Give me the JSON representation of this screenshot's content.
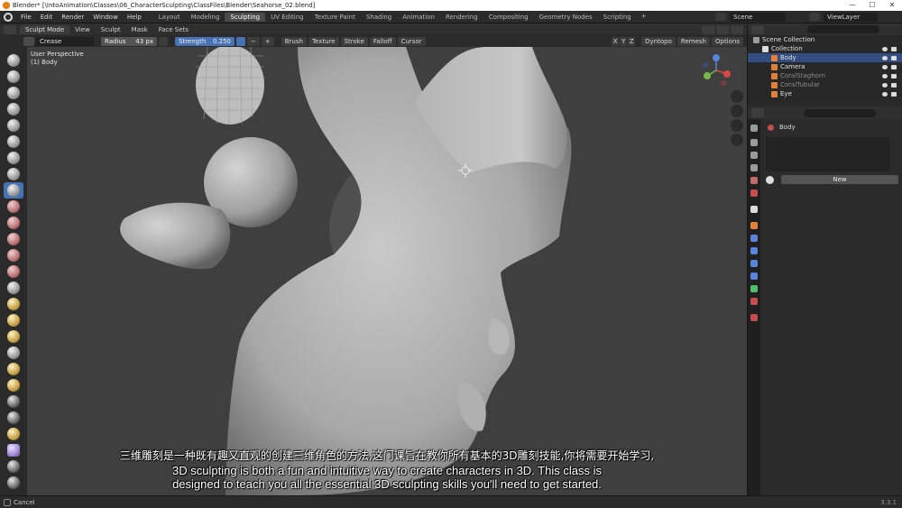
{
  "window": {
    "title": "Blender* [\\IntoAnimation\\Classes\\06_CharacterSculpting\\ClassFiles\\Blender\\Seahorse_02.blend]",
    "controls": [
      "—",
      "☐",
      "✕"
    ]
  },
  "menu": [
    "File",
    "Edit",
    "Render",
    "Window",
    "Help"
  ],
  "workspaces": [
    {
      "label": "Layout",
      "active": false
    },
    {
      "label": "Modeling",
      "active": false
    },
    {
      "label": "Sculpting",
      "active": true
    },
    {
      "label": "UV Editing",
      "active": false
    },
    {
      "label": "Texture Paint",
      "active": false
    },
    {
      "label": "Shading",
      "active": false
    },
    {
      "label": "Animation",
      "active": false
    },
    {
      "label": "Rendering",
      "active": false
    },
    {
      "label": "Compositing",
      "active": false
    },
    {
      "label": "Geometry Nodes",
      "active": false
    },
    {
      "label": "Scripting",
      "active": false
    }
  ],
  "workspace_add": "+",
  "scene": {
    "label": "Scene"
  },
  "view_layer": {
    "label": "ViewLayer"
  },
  "viewport_header": {
    "mode": "Sculpt Mode",
    "menus": [
      "View",
      "Sculpt",
      "Mask",
      "Face Sets"
    ],
    "axes": [
      "X",
      "Y",
      "Z"
    ],
    "dyntopo": "Dyntopo",
    "remesh": "Remesh",
    "options": "Options"
  },
  "tool_settings": {
    "brush_name": "Crease",
    "radius_label": "Radius",
    "radius_value": "43 px",
    "strength_label": "Strength",
    "strength_value": "0.250",
    "minus": "−",
    "plus": "+",
    "dropdowns": [
      "Brush",
      "Texture",
      "Stroke",
      "Falloff",
      "Cursor"
    ]
  },
  "viewport": {
    "perspective": "User Perspective",
    "object": "(1) Body"
  },
  "subtitles": {
    "cn": "三维雕刻是一种既有趣又直观的创建三维角色的方法,这门课旨在教你所有基本的3D雕刻技能,你将需要开始学习,",
    "en_line1": "3D sculpting is both a fun and intuitive way to create characters in 3D. This class is",
    "en_line2": "designed to teach you all the essential 3D sculpting skills you'll need to get started."
  },
  "outliner": {
    "rows": [
      {
        "name": "Scene Collection",
        "indent": 0,
        "color": "#9a9a9a",
        "dim": false,
        "selected": false
      },
      {
        "name": "Collection",
        "indent": 1,
        "color": "#dcdcdc",
        "dim": false,
        "selected": false
      },
      {
        "name": "Body",
        "indent": 2,
        "color": "#e0803a",
        "dim": false,
        "selected": true
      },
      {
        "name": "Camera",
        "indent": 2,
        "color": "#e0803a",
        "dim": false,
        "selected": false
      },
      {
        "name": "CoralStaghorn",
        "indent": 2,
        "color": "#e0803a",
        "dim": true,
        "selected": false
      },
      {
        "name": "CoralTubular",
        "indent": 2,
        "color": "#e0803a",
        "dim": true,
        "selected": false
      },
      {
        "name": "Eye",
        "indent": 2,
        "color": "#e0803a",
        "dim": false,
        "selected": false
      }
    ]
  },
  "properties": {
    "material_object": "Body",
    "new_button": "New"
  },
  "status": {
    "cancel": "Cancel",
    "version": "3.3.1"
  },
  "colors": {
    "accent": "#4772b3",
    "selected_row": "#334d80",
    "viewport_bg": "#3d3d3d"
  }
}
